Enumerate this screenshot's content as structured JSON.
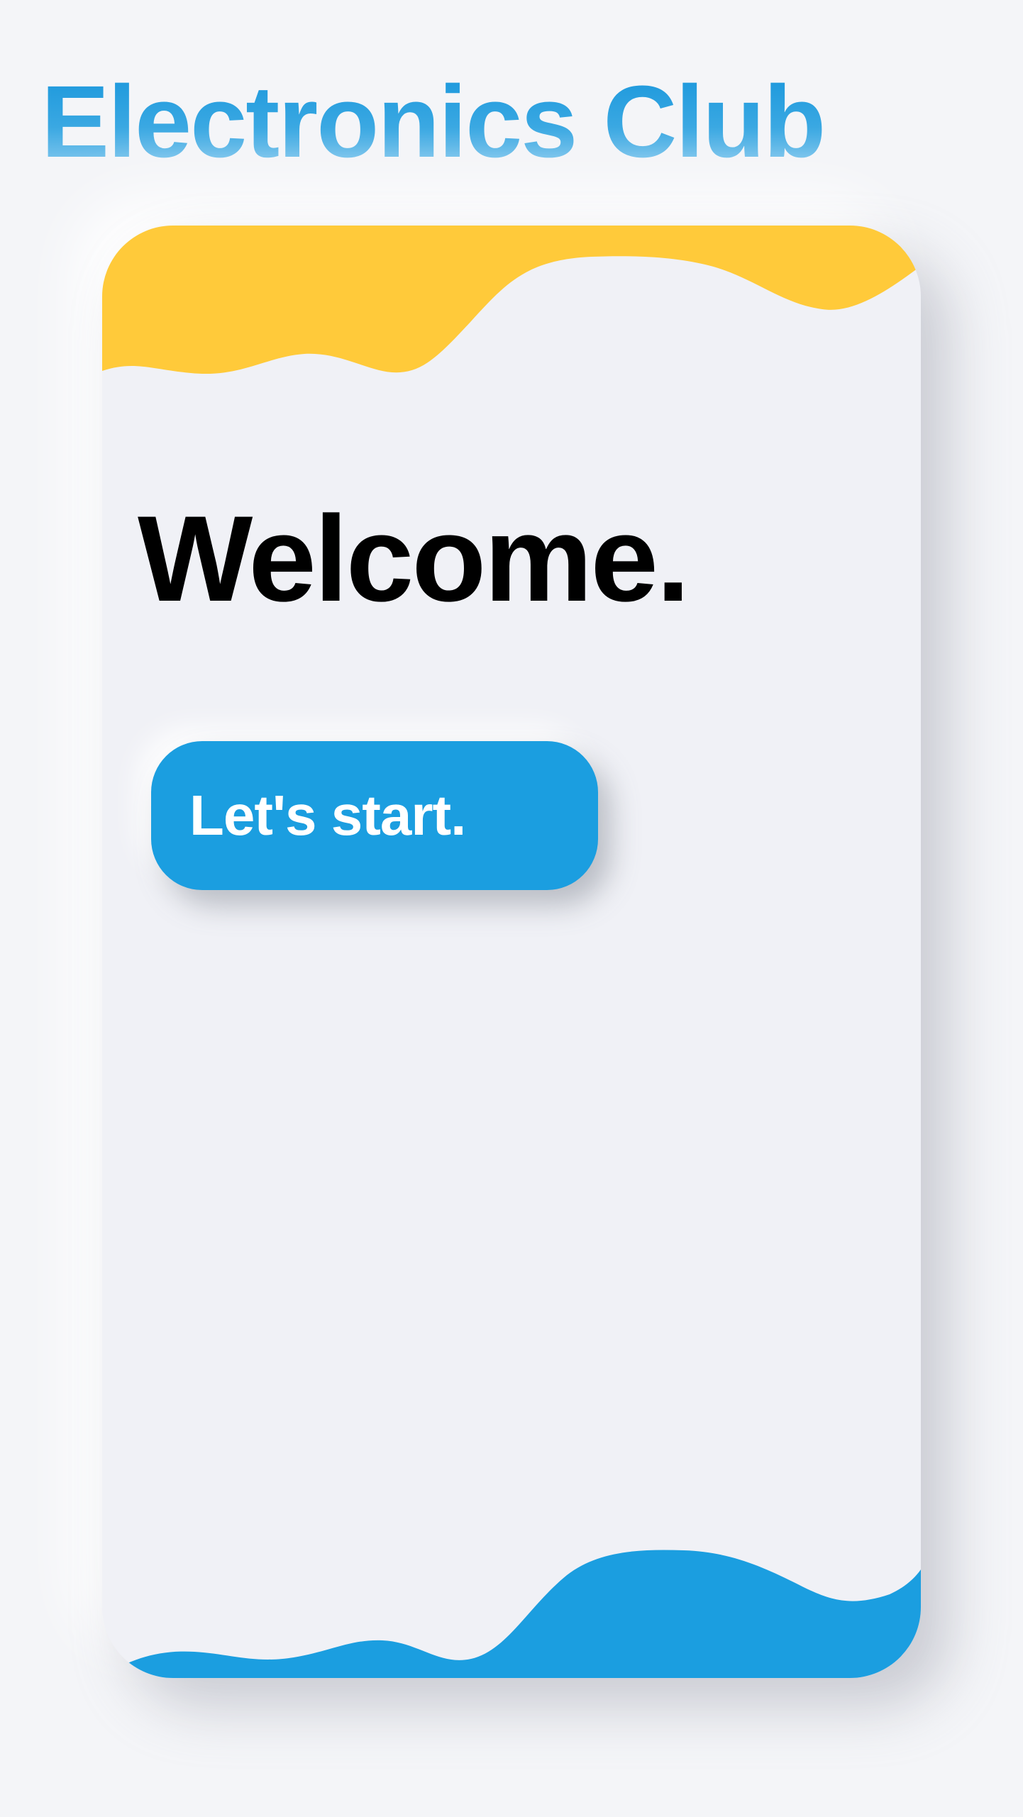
{
  "app": {
    "title": "Electronics Club"
  },
  "card": {
    "heading": "Welcome.",
    "start_button_label": "Let's start."
  },
  "colors": {
    "title_gradient_top": "#1a97dc",
    "title_gradient_bottom": "#8fcdf0",
    "wave_top": "#ffca3a",
    "wave_bottom": "#1b9ee0",
    "button": "#1b9ee0",
    "card_background": "#f0f1f6",
    "page_background": "#f4f5f8"
  }
}
